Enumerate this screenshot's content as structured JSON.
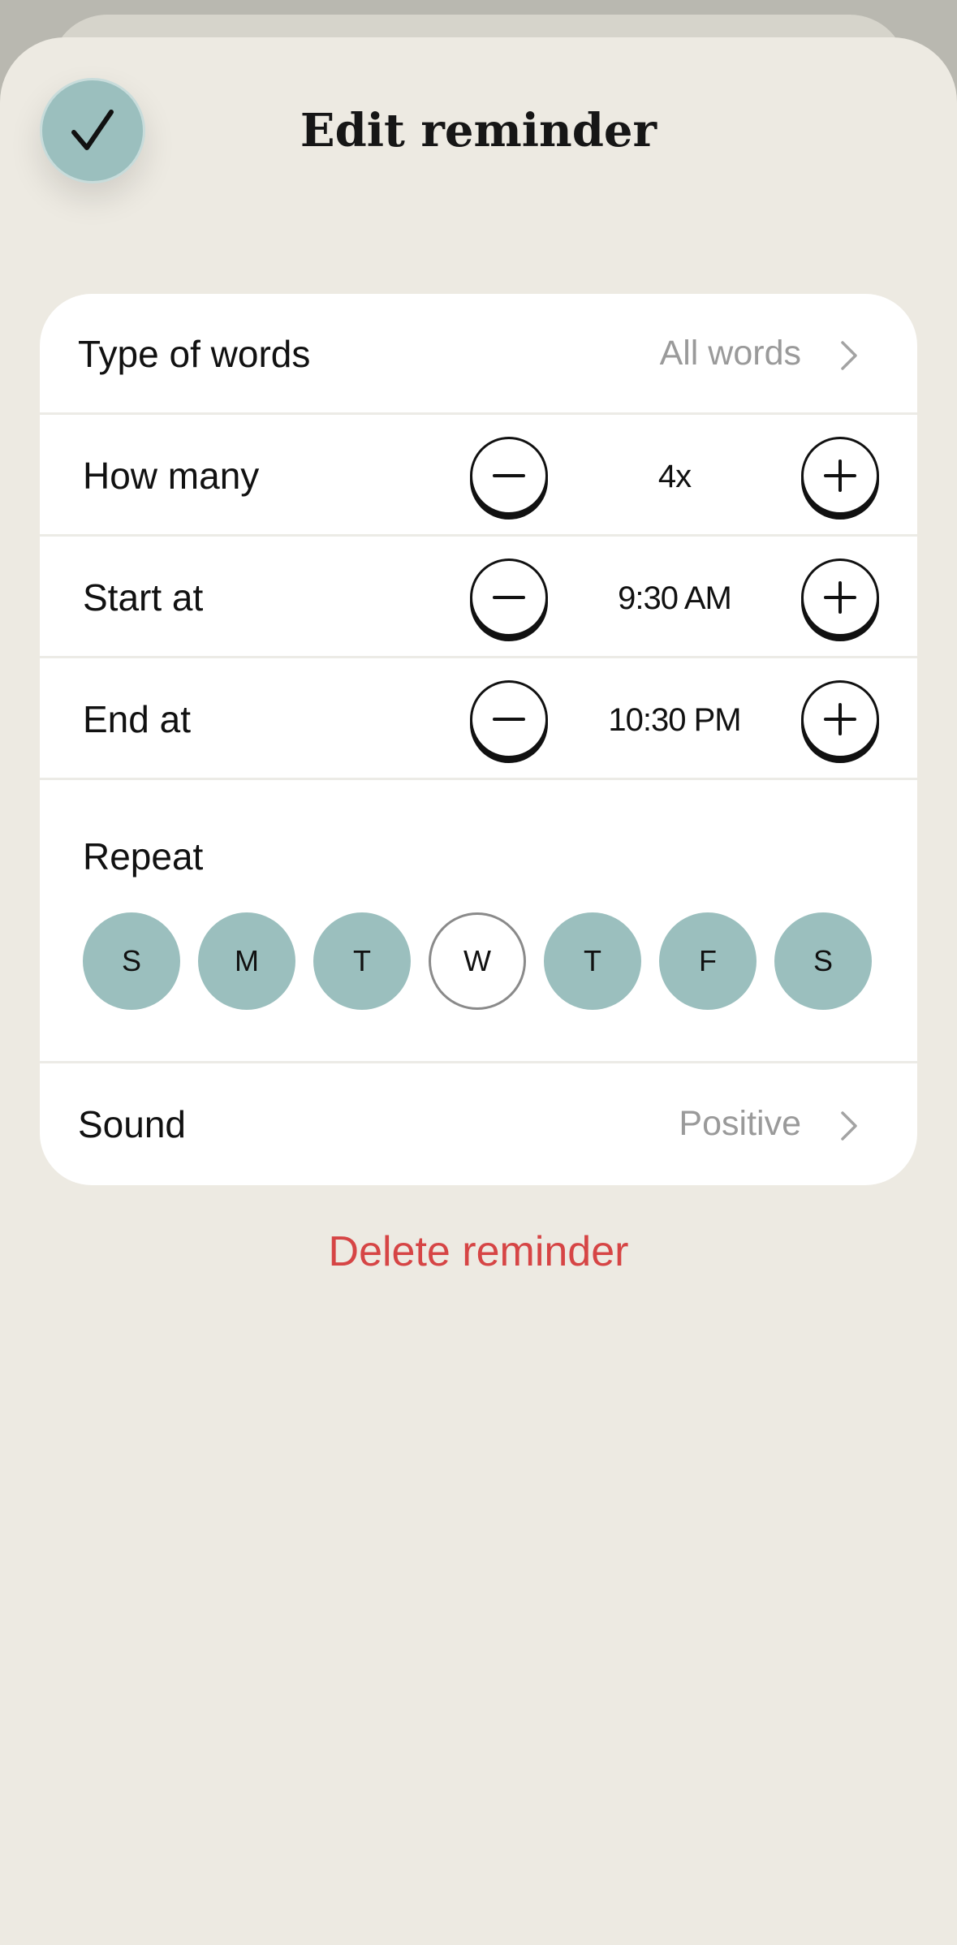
{
  "header": {
    "title": "Edit reminder"
  },
  "settings": {
    "type_of_words": {
      "label": "Type of words",
      "value": "All words"
    },
    "how_many": {
      "label": "How many",
      "value": "4x"
    },
    "start_at": {
      "label": "Start at",
      "value": "9:30 AM"
    },
    "end_at": {
      "label": "End at",
      "value": "10:30 PM"
    },
    "repeat": {
      "label": "Repeat",
      "days": [
        {
          "letter": "S",
          "selected": true
        },
        {
          "letter": "M",
          "selected": true
        },
        {
          "letter": "T",
          "selected": true
        },
        {
          "letter": "W",
          "selected": false
        },
        {
          "letter": "T",
          "selected": true
        },
        {
          "letter": "F",
          "selected": true
        },
        {
          "letter": "S",
          "selected": true
        }
      ]
    },
    "sound": {
      "label": "Sound",
      "value": "Positive"
    }
  },
  "actions": {
    "delete_label": "Delete reminder"
  },
  "colors": {
    "accent": "#9bbfbe",
    "danger": "#d64545",
    "background": "#edeae2"
  },
  "icons": [
    "checkmark-icon",
    "chevron-right-icon",
    "minus-icon",
    "plus-icon"
  ]
}
